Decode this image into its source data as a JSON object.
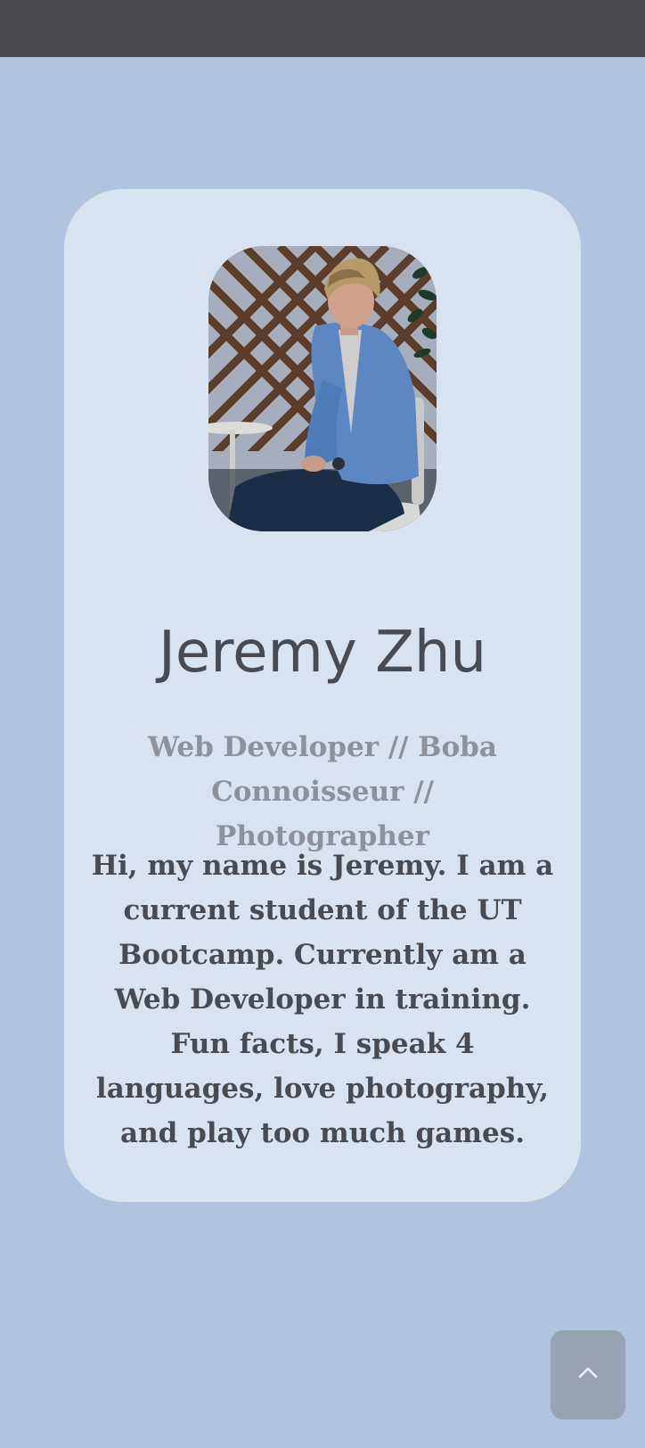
{
  "profile": {
    "name": "Jeremy Zhu",
    "tagline": "Web Developer // Boba Connoisseur // Photographer",
    "bio": "Hi, my name is Jeremy. I am a current student of the UT Bootcamp. Currently am a Web Developer in training. Fun facts, I speak 4 languages, love photography, and play too much games.",
    "photo_icon": "profile-photo"
  },
  "controls": {
    "back_to_top_icon": "chevron-up-icon"
  },
  "colors": {
    "page_background": "#b0c4df",
    "top_bar": "#4a4b50",
    "card": "#d9e2ef",
    "name_text": "#4a4b50",
    "tagline_text": "#8e9198",
    "bio_text": "#4a4b50",
    "back_to_top_button": "#98a2b1"
  }
}
